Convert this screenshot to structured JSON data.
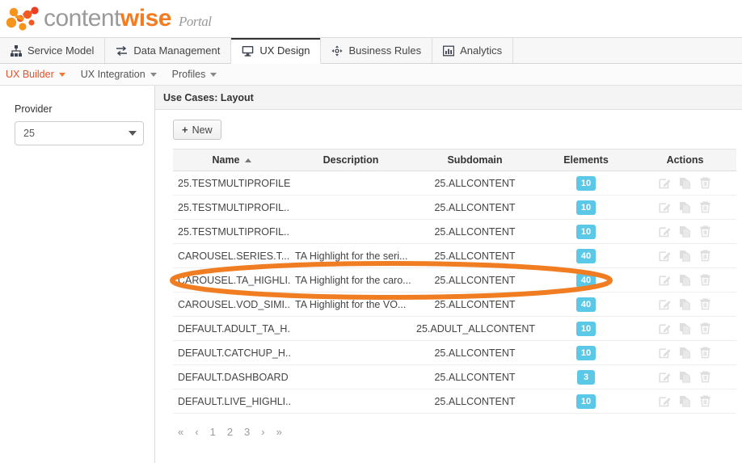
{
  "brand": {
    "name_part1": "content",
    "name_part2": "wise",
    "suffix": "Portal",
    "orange": "#f47b20",
    "grey": "#9a9a9a"
  },
  "main_tabs": [
    {
      "label": "Service Model",
      "icon": "sitemap-icon",
      "active": false
    },
    {
      "label": "Data Management",
      "icon": "exchange-icon",
      "active": false
    },
    {
      "label": "UX Design",
      "icon": "monitor-icon",
      "active": true
    },
    {
      "label": "Business Rules",
      "icon": "move-arrows-icon",
      "active": false
    },
    {
      "label": "Analytics",
      "icon": "bar-chart-icon",
      "active": false
    }
  ],
  "subnav": [
    {
      "label": "UX Builder",
      "accent": true
    },
    {
      "label": "UX Integration",
      "accent": false
    },
    {
      "label": "Profiles",
      "accent": false
    }
  ],
  "sidebar": {
    "provider_label": "Provider",
    "provider_value": "25"
  },
  "panel": {
    "title": "Use Cases: Layout",
    "new_button": "New",
    "new_button_icon": "plus-icon"
  },
  "table": {
    "columns": [
      "Name",
      "Description",
      "Subdomain",
      "Elements",
      "Actions"
    ],
    "sort_column": "Name",
    "sort_direction": "asc",
    "rows": [
      {
        "name": "25.TESTMULTIPROFILE",
        "description": "",
        "subdomain": "25.ALLCONTENT",
        "elements": "10"
      },
      {
        "name": "25.TESTMULTIPROFIL...",
        "description": "",
        "subdomain": "25.ALLCONTENT",
        "elements": "10"
      },
      {
        "name": "25.TESTMULTIPROFIL...",
        "description": "",
        "subdomain": "25.ALLCONTENT",
        "elements": "10"
      },
      {
        "name": "CAROUSEL.SERIES.T...",
        "description": "TA Highlight for the seri...",
        "subdomain": "25.ALLCONTENT",
        "elements": "40"
      },
      {
        "name": "CAROUSEL.TA_HIGHLI...",
        "description": "TA Highlight for the caro...",
        "subdomain": "25.ALLCONTENT",
        "elements": "40"
      },
      {
        "name": "CAROUSEL.VOD_SIMI...",
        "description": "TA Highlight for the VO...",
        "subdomain": "25.ALLCONTENT",
        "elements": "40"
      },
      {
        "name": "DEFAULT.ADULT_TA_H...",
        "description": "",
        "subdomain": "25.ADULT_ALLCONTENT",
        "elements": "10"
      },
      {
        "name": "DEFAULT.CATCHUP_H...",
        "description": "",
        "subdomain": "25.ALLCONTENT",
        "elements": "10"
      },
      {
        "name": "DEFAULT.DASHBOARD",
        "description": "",
        "subdomain": "25.ALLCONTENT",
        "elements": "3"
      },
      {
        "name": "DEFAULT.LIVE_HIGHLI...",
        "description": "",
        "subdomain": "25.ALLCONTENT",
        "elements": "10"
      }
    ],
    "row_actions": [
      "edit-icon",
      "copy-icon",
      "delete-icon"
    ],
    "badge_color": "#5bc8e8"
  },
  "pagination": {
    "first": "«",
    "prev": "‹",
    "pages": [
      "1",
      "2",
      "3"
    ],
    "next": "›",
    "last": "»",
    "current_page": "1"
  },
  "annotation": {
    "shape": "ellipse",
    "color": "#f07d22",
    "target_row_index": 4
  }
}
